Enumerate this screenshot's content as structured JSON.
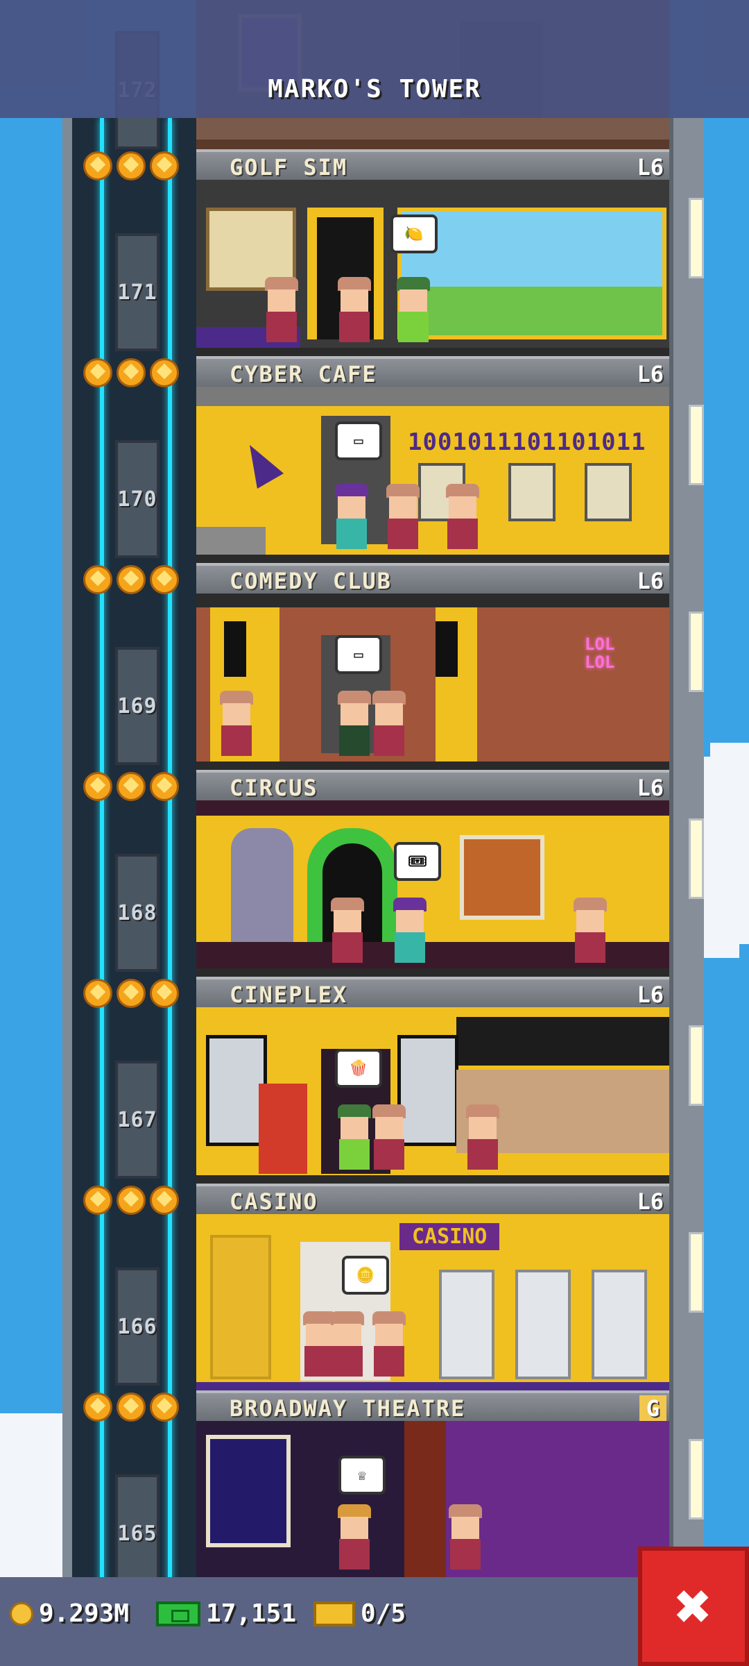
{
  "header": {
    "title": "MARKO'S TOWER"
  },
  "floors": [
    {
      "number": "172",
      "name": "",
      "level": ""
    },
    {
      "number": "171",
      "name": "GOLF SIM",
      "level": "L6"
    },
    {
      "number": "170",
      "name": "CYBER CAFE",
      "level": "L6",
      "sign": "1001011101101011"
    },
    {
      "number": "169",
      "name": "COMEDY CLUB",
      "level": "L6",
      "sign": "LOL LOL"
    },
    {
      "number": "168",
      "name": "CIRCUS",
      "level": "L6"
    },
    {
      "number": "167",
      "name": "CINEPLEX",
      "level": "L6"
    },
    {
      "number": "166",
      "name": "CASINO",
      "level": "L6",
      "sign": "CASINO"
    },
    {
      "number": "165",
      "name": "BROADWAY THEATRE",
      "level": "G"
    }
  ],
  "hud": {
    "coins": "9.293M",
    "bux": "17,151",
    "tickets": "0/5",
    "close_label": "✖"
  },
  "colors": {
    "sky": "#3aa3e6",
    "hud_bg": "#5a6383",
    "close_button": "#e02a2a",
    "elevator_cable": "#22e1ff",
    "room_yellow": "#f0c020"
  },
  "icons": [
    "coin-icon",
    "cash-icon",
    "ticket-icon",
    "close-icon",
    "star-icon"
  ]
}
